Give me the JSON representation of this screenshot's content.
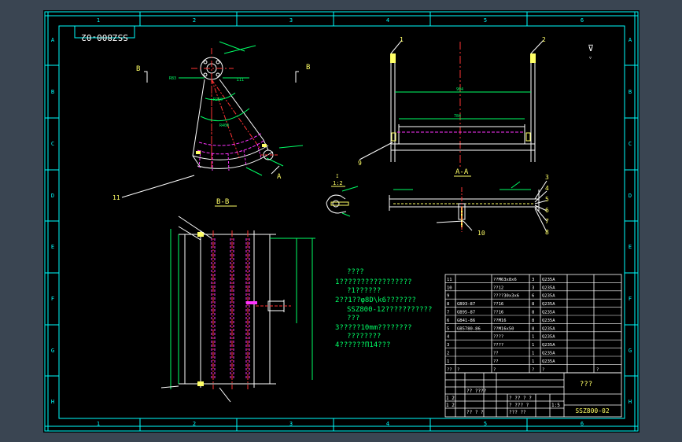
{
  "drawing": {
    "code_rotated": "SSZ800-02",
    "column_numbers": [
      "1",
      "2",
      "3",
      "4",
      "5",
      "6"
    ],
    "row_letters": [
      "A",
      "B",
      "C",
      "D",
      "E",
      "F",
      "G",
      "H"
    ]
  },
  "views": {
    "section_b_left": "B",
    "section_b_right": "B",
    "section_a": "A",
    "section_aa": "A-A",
    "section_bb": "B-B",
    "detail_id": "I",
    "detail_scale": "1:2"
  },
  "roughness_symbol": "⊽",
  "callouts": [
    "1",
    "2",
    "3",
    "4",
    "5",
    "6",
    "7",
    "8",
    "9",
    "10",
    "11"
  ],
  "notes": {
    "title": "????",
    "lines": [
      "1?????????????????",
      "?1??????",
      "2??1??φ8D\\k6???????",
      "SSZ800-12???????????",
      "???",
      "3?????10mm????????",
      "????????",
      "4??????Π14???"
    ]
  },
  "bom": {
    "rows": [
      {
        "no": "11",
        "code": "",
        "name": "??M63x8x6",
        "qty": "3",
        "mat": "Q235A"
      },
      {
        "no": "10",
        "code": "",
        "name": "??12",
        "qty": "3",
        "mat": "Q235A"
      },
      {
        "no": "9",
        "code": "",
        "name": "????30x3x6",
        "qty": "6",
        "mat": "Q235A"
      },
      {
        "no": "8",
        "code": "GB93-87",
        "name": "??16",
        "qty": "8",
        "mat": "Q235A"
      },
      {
        "no": "7",
        "code": "GB95-87",
        "name": "??16",
        "qty": "8",
        "mat": "Q235A"
      },
      {
        "no": "6",
        "code": "GB41-86",
        "name": "??M16",
        "qty": "8",
        "mat": "Q235A"
      },
      {
        "no": "5",
        "code": "GB5780-86",
        "name": "??M16x50",
        "qty": "8",
        "mat": "Q235A"
      },
      {
        "no": "4",
        "code": "",
        "name": "????",
        "qty": "1",
        "mat": "Q235A"
      },
      {
        "no": "3",
        "code": "",
        "name": "????",
        "qty": "1",
        "mat": "Q235A"
      },
      {
        "no": "2",
        "code": "",
        "name": "??",
        "qty": "1",
        "mat": "Q235A"
      },
      {
        "no": "1",
        "code": "",
        "name": "??",
        "qty": "1",
        "mat": "Q235A"
      }
    ],
    "header": {
      "no": "??",
      "code": "?",
      "name": "?",
      "qty": "?",
      "mat": "?",
      "extra": "?"
    }
  },
  "title_block": {
    "name": "???",
    "code": "SSZ800-02",
    "scale": "1:5",
    "cells": [
      "1 2",
      "1 2",
      "?? ????",
      "? ?? ? ?",
      "? ??? ?",
      "?? ? ?",
      "??? ??"
    ]
  },
  "colors": {
    "border": "#00ffff",
    "outline": "#ffffff",
    "centerline": "#ff3333",
    "hidden": "#ff33ff",
    "dimension": "#00ff66",
    "text": "#ffff66",
    "canvas": "#000000",
    "frame_bg": "#3a4552"
  }
}
